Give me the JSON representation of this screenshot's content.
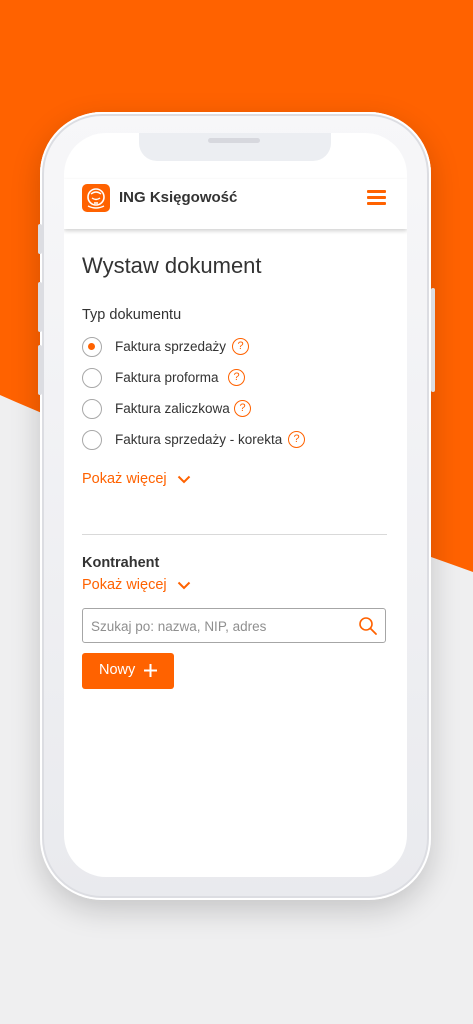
{
  "colors": {
    "accent": "#ff6200",
    "text": "#333333",
    "background": "#efeff0"
  },
  "header": {
    "app_title": "ING Księgowość",
    "logo_icon": "lion-logo-icon",
    "menu_icon": "hamburger-menu-icon"
  },
  "main": {
    "page_title": "Wystaw dokument",
    "document_type": {
      "label": "Typ dokumentu",
      "options": [
        {
          "label": "Faktura sprzedaży",
          "selected": true
        },
        {
          "label": "Faktura proforma",
          "selected": false
        },
        {
          "label": "Faktura zaliczkowa",
          "selected": false
        },
        {
          "label": "Faktura sprzedaży - korekta",
          "selected": false
        }
      ],
      "show_more_label": "Pokaż więcej"
    },
    "contractor": {
      "label": "Kontrahent",
      "show_more_label": "Pokaż więcej",
      "search_placeholder": "Szukaj po: nazwa, NIP, adres",
      "search_value": "",
      "new_button_label": "Nowy"
    }
  }
}
